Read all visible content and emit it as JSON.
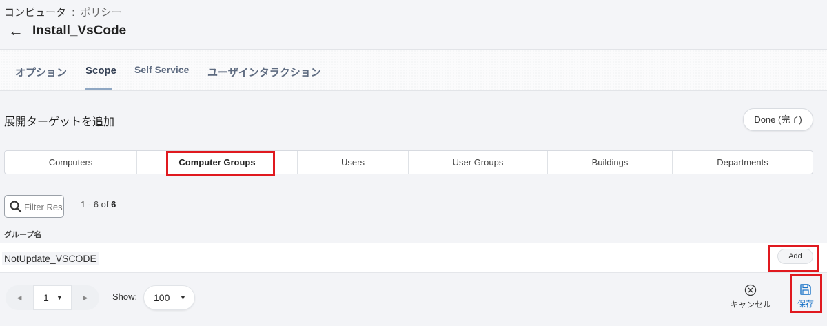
{
  "breadcrumb": {
    "parent": "コンピュータ",
    "separator": ":",
    "current": "ポリシー"
  },
  "back_icon": "arrow-left-icon",
  "page_title": "Install_VsCode",
  "tabs": [
    {
      "label": "オプション",
      "active": false
    },
    {
      "label": "Scope",
      "active": true
    },
    {
      "label": "Self Service",
      "active": false
    },
    {
      "label": "ユーザインタラクション",
      "active": false
    }
  ],
  "section": {
    "title": "展開ターゲットを追加",
    "done_label": "Done (完了)"
  },
  "segments": [
    {
      "label": "Computers",
      "active": false
    },
    {
      "label": "Computer Groups",
      "active": true
    },
    {
      "label": "Users",
      "active": false
    },
    {
      "label": "User Groups",
      "active": false
    },
    {
      "label": "Buildings",
      "active": false
    },
    {
      "label": "Departments",
      "active": false
    }
  ],
  "filter": {
    "placeholder": "Filter Results",
    "icon": "search-icon"
  },
  "range": {
    "prefix": "1 - 6 of",
    "total": "6"
  },
  "table": {
    "column_header": "グループ名",
    "rows": [
      {
        "name": "NotUpdate_VSCODE",
        "action_label": "Add"
      }
    ]
  },
  "pagination": {
    "prev_icon": "chevron-left-icon",
    "next_icon": "chevron-right-icon",
    "current_page": "1",
    "show_label": "Show:",
    "per_page": "100"
  },
  "footer": {
    "cancel_label": "キャンセル",
    "cancel_icon": "close-circle-icon",
    "save_label": "保存",
    "save_icon": "floppy-disk-icon"
  },
  "colors": {
    "highlight": "#e0191f",
    "save_accent": "#1a73c7",
    "active_tab_underline": "#8fa7c3"
  }
}
